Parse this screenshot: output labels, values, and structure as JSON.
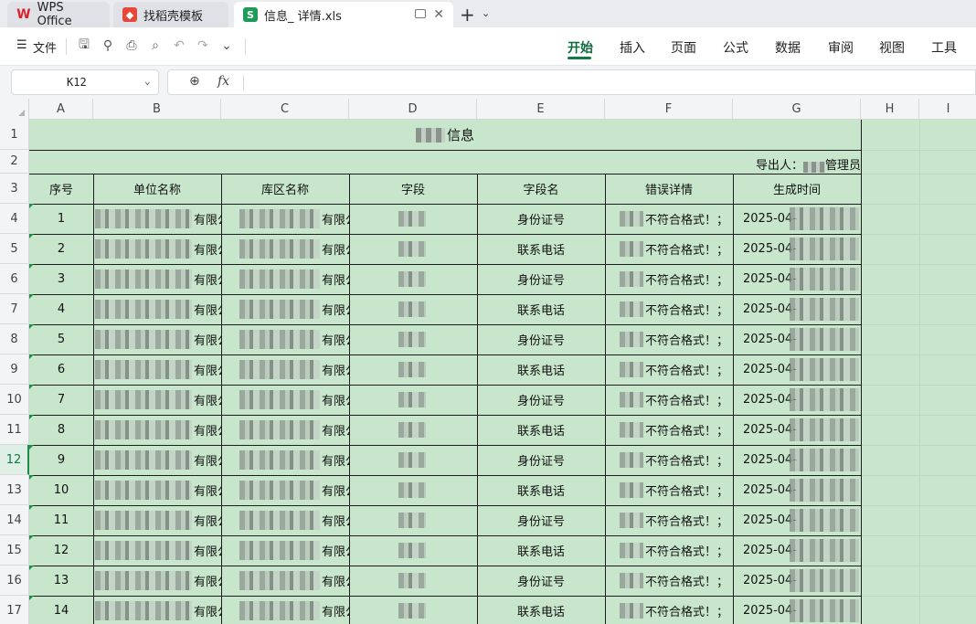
{
  "tabs": [
    {
      "label": "WPS Office",
      "icon": "wps-logo-icon",
      "color": "#d9232d"
    },
    {
      "label": "找稻壳模板",
      "icon": "docer-logo-icon",
      "color": "#e5483a"
    },
    {
      "label": "信息_ 详情.xls",
      "icon": "spreadsheet-icon",
      "color": "#1e9b57"
    }
  ],
  "toolbar": {
    "file_label": "文件",
    "menu_tabs": [
      "开始",
      "插入",
      "页面",
      "公式",
      "数据",
      "审阅",
      "视图",
      "工具"
    ],
    "active_tab": "开始"
  },
  "formula_bar": {
    "cell_ref": "K12",
    "fx_label": "fx",
    "value": ""
  },
  "sheet": {
    "columns": [
      "A",
      "B",
      "C",
      "D",
      "E",
      "F",
      "G",
      "H",
      "I"
    ],
    "rows": [
      "1",
      "2",
      "3",
      "4",
      "5",
      "6",
      "7",
      "8",
      "9",
      "10",
      "11",
      "12",
      "13",
      "14",
      "15",
      "16",
      "17"
    ],
    "selected_row": "12",
    "title": "信息",
    "exporter_label": "导出人：",
    "exporter_value": "管理员",
    "headers": [
      "序号",
      "单位名称",
      "库区名称",
      "字段",
      "字段名",
      "错误详情",
      "生成时间"
    ],
    "records": [
      {
        "no": "1",
        "unit_tail": "有限公",
        "area_head": "市",
        "area_tail": "有限公",
        "field_name": "身份证号",
        "error": "不符合格式！；",
        "time": "2025-04-"
      },
      {
        "no": "2",
        "unit_tail": "有限公",
        "area_head": "市",
        "area_tail": "有限公",
        "field_name": "联系电话",
        "error": "不符合格式！；",
        "time": "2025-04-"
      },
      {
        "no": "3",
        "unit_tail": "有限公",
        "area_head": "市",
        "area_tail": "有限公",
        "field_name": "身份证号",
        "error": "不符合格式！；",
        "time": "2025-04-"
      },
      {
        "no": "4",
        "unit_tail": "有限公",
        "area_head": "市",
        "area_tail": "有限公",
        "field_name": "联系电话",
        "error": "不符合格式！；",
        "time": "2025-04-"
      },
      {
        "no": "5",
        "unit_tail": "有限公",
        "area_head": "市",
        "area_tail": "有限公",
        "field_name": "身份证号",
        "error": "不符合格式！；",
        "time": "2025-04-"
      },
      {
        "no": "6",
        "unit_tail": "有限公",
        "area_head": "市",
        "area_tail": "有限公",
        "field_name": "联系电话",
        "error": "不符合格式！；",
        "time": "2025-04-"
      },
      {
        "no": "7",
        "unit_tail": "有限公",
        "area_head": "市",
        "area_tail": "有限公",
        "field_name": "身份证号",
        "error": "不符合格式！；",
        "time": "2025-04-"
      },
      {
        "no": "8",
        "unit_tail": "有限公",
        "area_head": "市",
        "area_tail": "有限公",
        "field_name": "联系电话",
        "error": "不符合格式！；",
        "time": "2025-04-"
      },
      {
        "no": "9",
        "unit_tail": "有限公",
        "area_head": "市",
        "area_tail": "有限公",
        "field_name": "身份证号",
        "error": "不符合格式！；",
        "time": "2025-04-"
      },
      {
        "no": "10",
        "unit_tail": "有限公",
        "area_head": "市",
        "area_tail": "有限公",
        "field_name": "联系电话",
        "error": "不符合格式！；",
        "time": "2025-04-"
      },
      {
        "no": "11",
        "unit_tail": "有限公",
        "area_head": "市",
        "area_tail": "有限公",
        "field_name": "身份证号",
        "error": "不符合格式！；",
        "time": "2025-04-"
      },
      {
        "no": "12",
        "unit_tail": "有限公",
        "area_head": "市",
        "area_tail": "有限公",
        "field_name": "联系电话",
        "error": "不符合格式！；",
        "time": "2025-04-"
      },
      {
        "no": "13",
        "unit_tail": "有限公",
        "area_head": "市",
        "area_tail": "有限公",
        "field_name": "身份证号",
        "error": "不符合格式！；",
        "time": "2025-04-"
      },
      {
        "no": "14",
        "unit_tail": "有限公",
        "area_head": "市",
        "area_tail": "有限公",
        "field_name": "联系电话",
        "error": "不符合格式！；",
        "time": "2025-04-"
      }
    ]
  },
  "colors": {
    "sheet_bg": "#c8e6cc",
    "accent": "#0f7b45"
  }
}
